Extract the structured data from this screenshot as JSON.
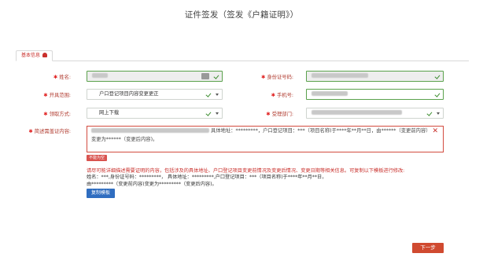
{
  "page": {
    "title": "证件签发（签发《户籍证明》）"
  },
  "tab": {
    "label": "基本信息"
  },
  "form": {
    "name_label": "姓名:",
    "id_label": "身份证号码:",
    "scope_label": "开具范围:",
    "scope_value": "户口登记项目内容变更更正",
    "phone_label": "手机号:",
    "delivery_label": "领取方式:",
    "delivery_value": "网上下载",
    "dept_label": "受理部门:",
    "content_label": "简述需盖证内容:",
    "content_line1_mid": "具体地址：*********，户口登记项目：***（项目名称)于****年**月**日，由******（变更前内容）",
    "content_line2": "变更为******（变更后内容)。",
    "error_tag": "不能为空"
  },
  "hint": {
    "warning": "请尽可能详细描述需要证明的内容，包括涉及的具体地址、户口登记项目变更前情况及变更后情况、变更日期等相关信息。可复制以下模板进行修改:",
    "template_line1": "姓名：***,身份证号码：*********，  具体地址：*********,户口登记项目：***（项目名称)于****年**月**日，",
    "template_line2": "由*********（变更前内容)变更为*********（变更后内容)。",
    "copy_button": "复制模板"
  },
  "footer": {
    "next_button": "下一步"
  },
  "colors": {
    "accent_red": "#c9302c",
    "valid_green": "#5aa14c",
    "primary_blue": "#2f6dc0",
    "next_orange": "#d04a30"
  }
}
